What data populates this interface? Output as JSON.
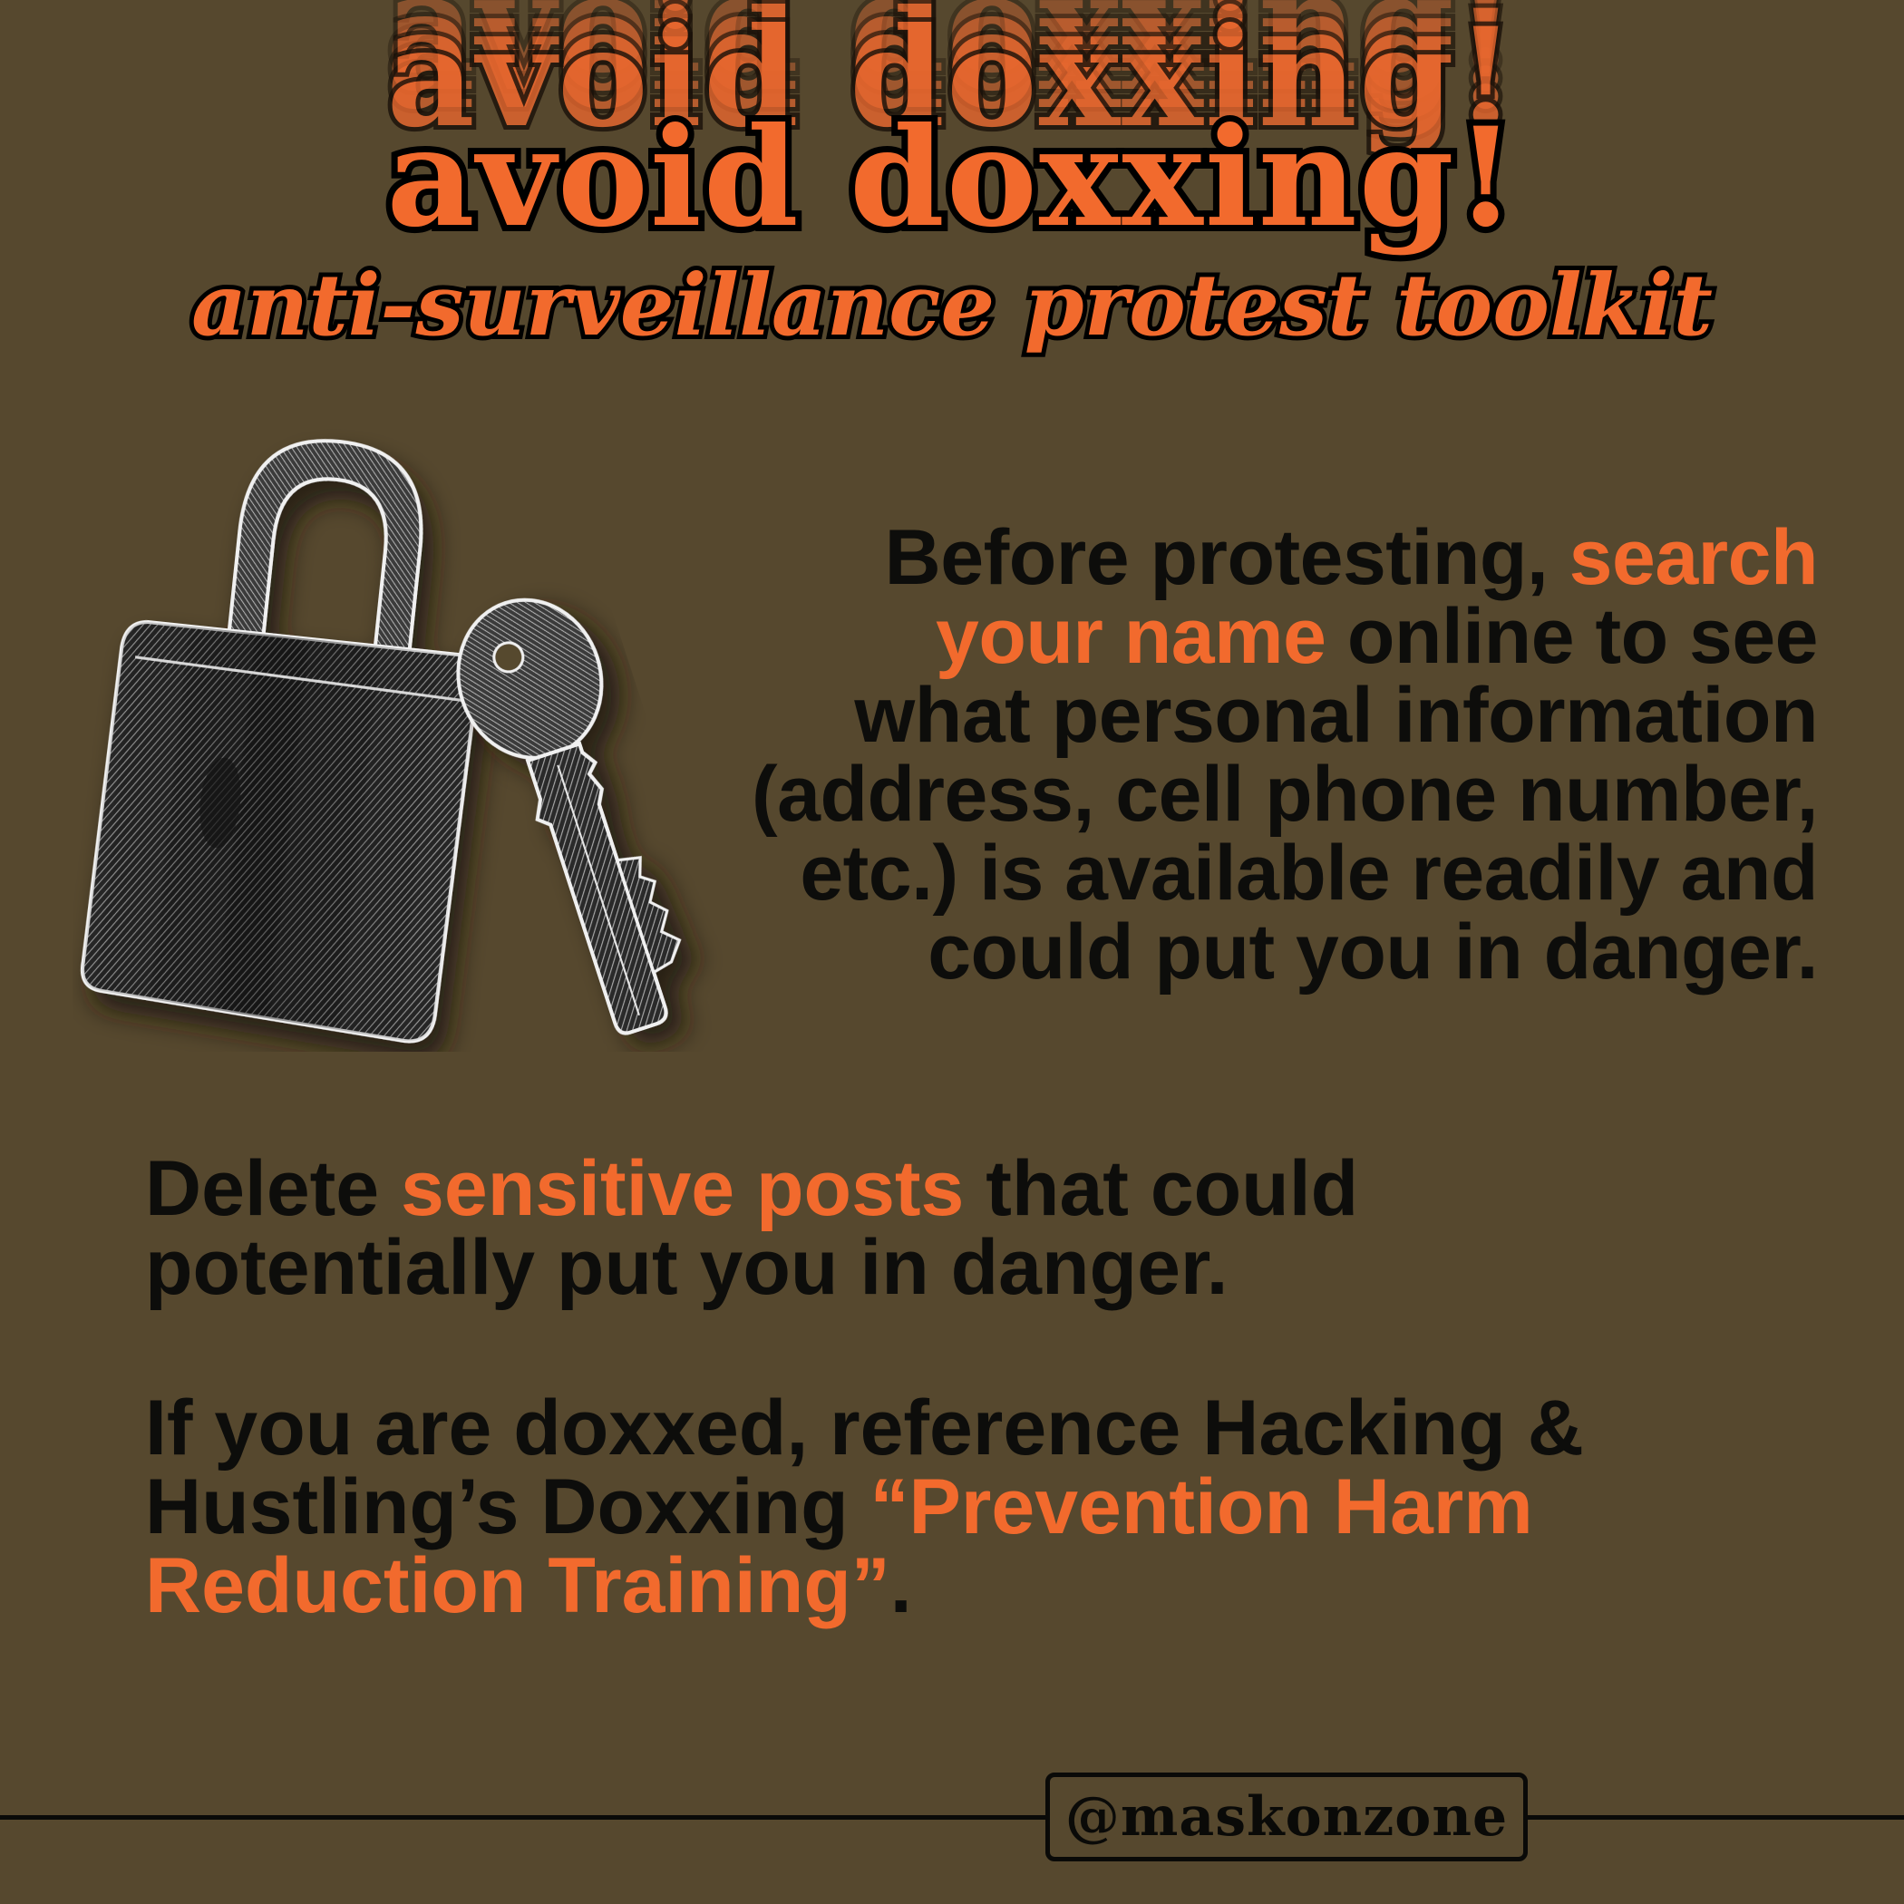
{
  "poster": {
    "title": "avoid doxxing!",
    "subtitle": "anti-surveillance protest toolkit",
    "colors": {
      "background": "#56482e",
      "accent": "#f26a2d",
      "text": "#0d0d0b"
    },
    "illustration": {
      "icons": [
        "padlock-icon",
        "key-icon"
      ]
    },
    "paragraph_1": {
      "before": "Before protesting, ",
      "highlight": "search your name",
      "after": " online to see what personal information (address, cell phone number, etc.) is available readily and could put you in danger."
    },
    "paragraph_2": {
      "before": "Delete ",
      "highlight": "sensitive posts",
      "after": " that could potentially put you in danger."
    },
    "paragraph_3": {
      "before": "If you are doxxed, reference Hacking & Hustling’s Doxxing ",
      "highlight": "“Prevention Harm Reduction Training”",
      "after": "."
    },
    "footer": {
      "handle": "@maskonzone"
    }
  }
}
